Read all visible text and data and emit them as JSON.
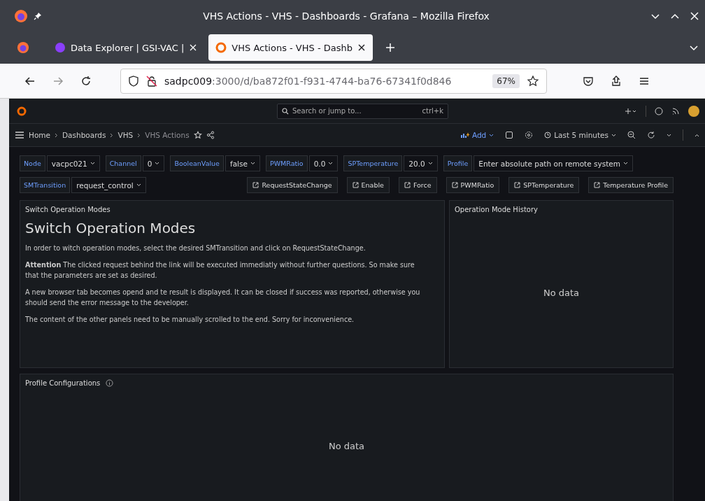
{
  "window": {
    "title": "VHS Actions - VHS - Dashboards - Grafana – Mozilla Firefox"
  },
  "browser_tabs": [
    {
      "label": "Data Explorer | GSI-VAC |",
      "selected": false
    },
    {
      "label": "VHS Actions - VHS - Dashb",
      "selected": true
    }
  ],
  "address_bar": {
    "host": "sadpc009",
    "path": ":3000/d/ba872f01-f931-4744-ba76-67341f0d846",
    "zoom": "67%"
  },
  "top_bar": {
    "search_placeholder": "Search or jump to...",
    "shortcut": "ctrl+k"
  },
  "breadcrumbs": [
    {
      "label": "Home",
      "current": false
    },
    {
      "label": "Dashboards",
      "current": false
    },
    {
      "label": "VHS",
      "current": false
    },
    {
      "label": "VHS Actions",
      "current": true
    }
  ],
  "toolbar": {
    "add": "Add",
    "time_range": "Last 5 minutes"
  },
  "variables": [
    {
      "label": "Node",
      "value": "vacpc021"
    },
    {
      "label": "Channel",
      "value": "0"
    },
    {
      "label": "BooleanValue",
      "value": "false"
    },
    {
      "label": "PWMRatio",
      "value": "0.0"
    },
    {
      "label": "SPTemperature",
      "value": "20.0"
    },
    {
      "label": "Profile",
      "value": "Enter absolute path on remote system"
    },
    {
      "label": "SMTransition",
      "value": "request_control"
    }
  ],
  "links": [
    "RequestStateChange",
    "Enable",
    "Force",
    "PWMRatio",
    "SPTemperature",
    "Temperature Profile"
  ],
  "panels": [
    {
      "kind": "text",
      "title": "Switch Operation Modes",
      "heading": "Switch Operation Modes",
      "paragraphs": [
        "In order to witch operation modes, select the desired SMTransition and click on RequestStateChange.",
        "**Attention** The clicked request behind the link will be executed immediatly without further questions. So make sure that the parameters are set as desired.",
        "A new browser tab becomes opend and te result is displayed. It can be closed if success was reported, otherwise you should send the error message to the developer.",
        "The content of the other panels need to be manually scrolled to the end. Sorry for inconvenience."
      ]
    },
    {
      "kind": "empty",
      "title": "Operation Mode History",
      "message": "No data",
      "info": false
    },
    {
      "kind": "empty",
      "title": "Profile Configurations",
      "message": "No data",
      "info": true
    }
  ]
}
